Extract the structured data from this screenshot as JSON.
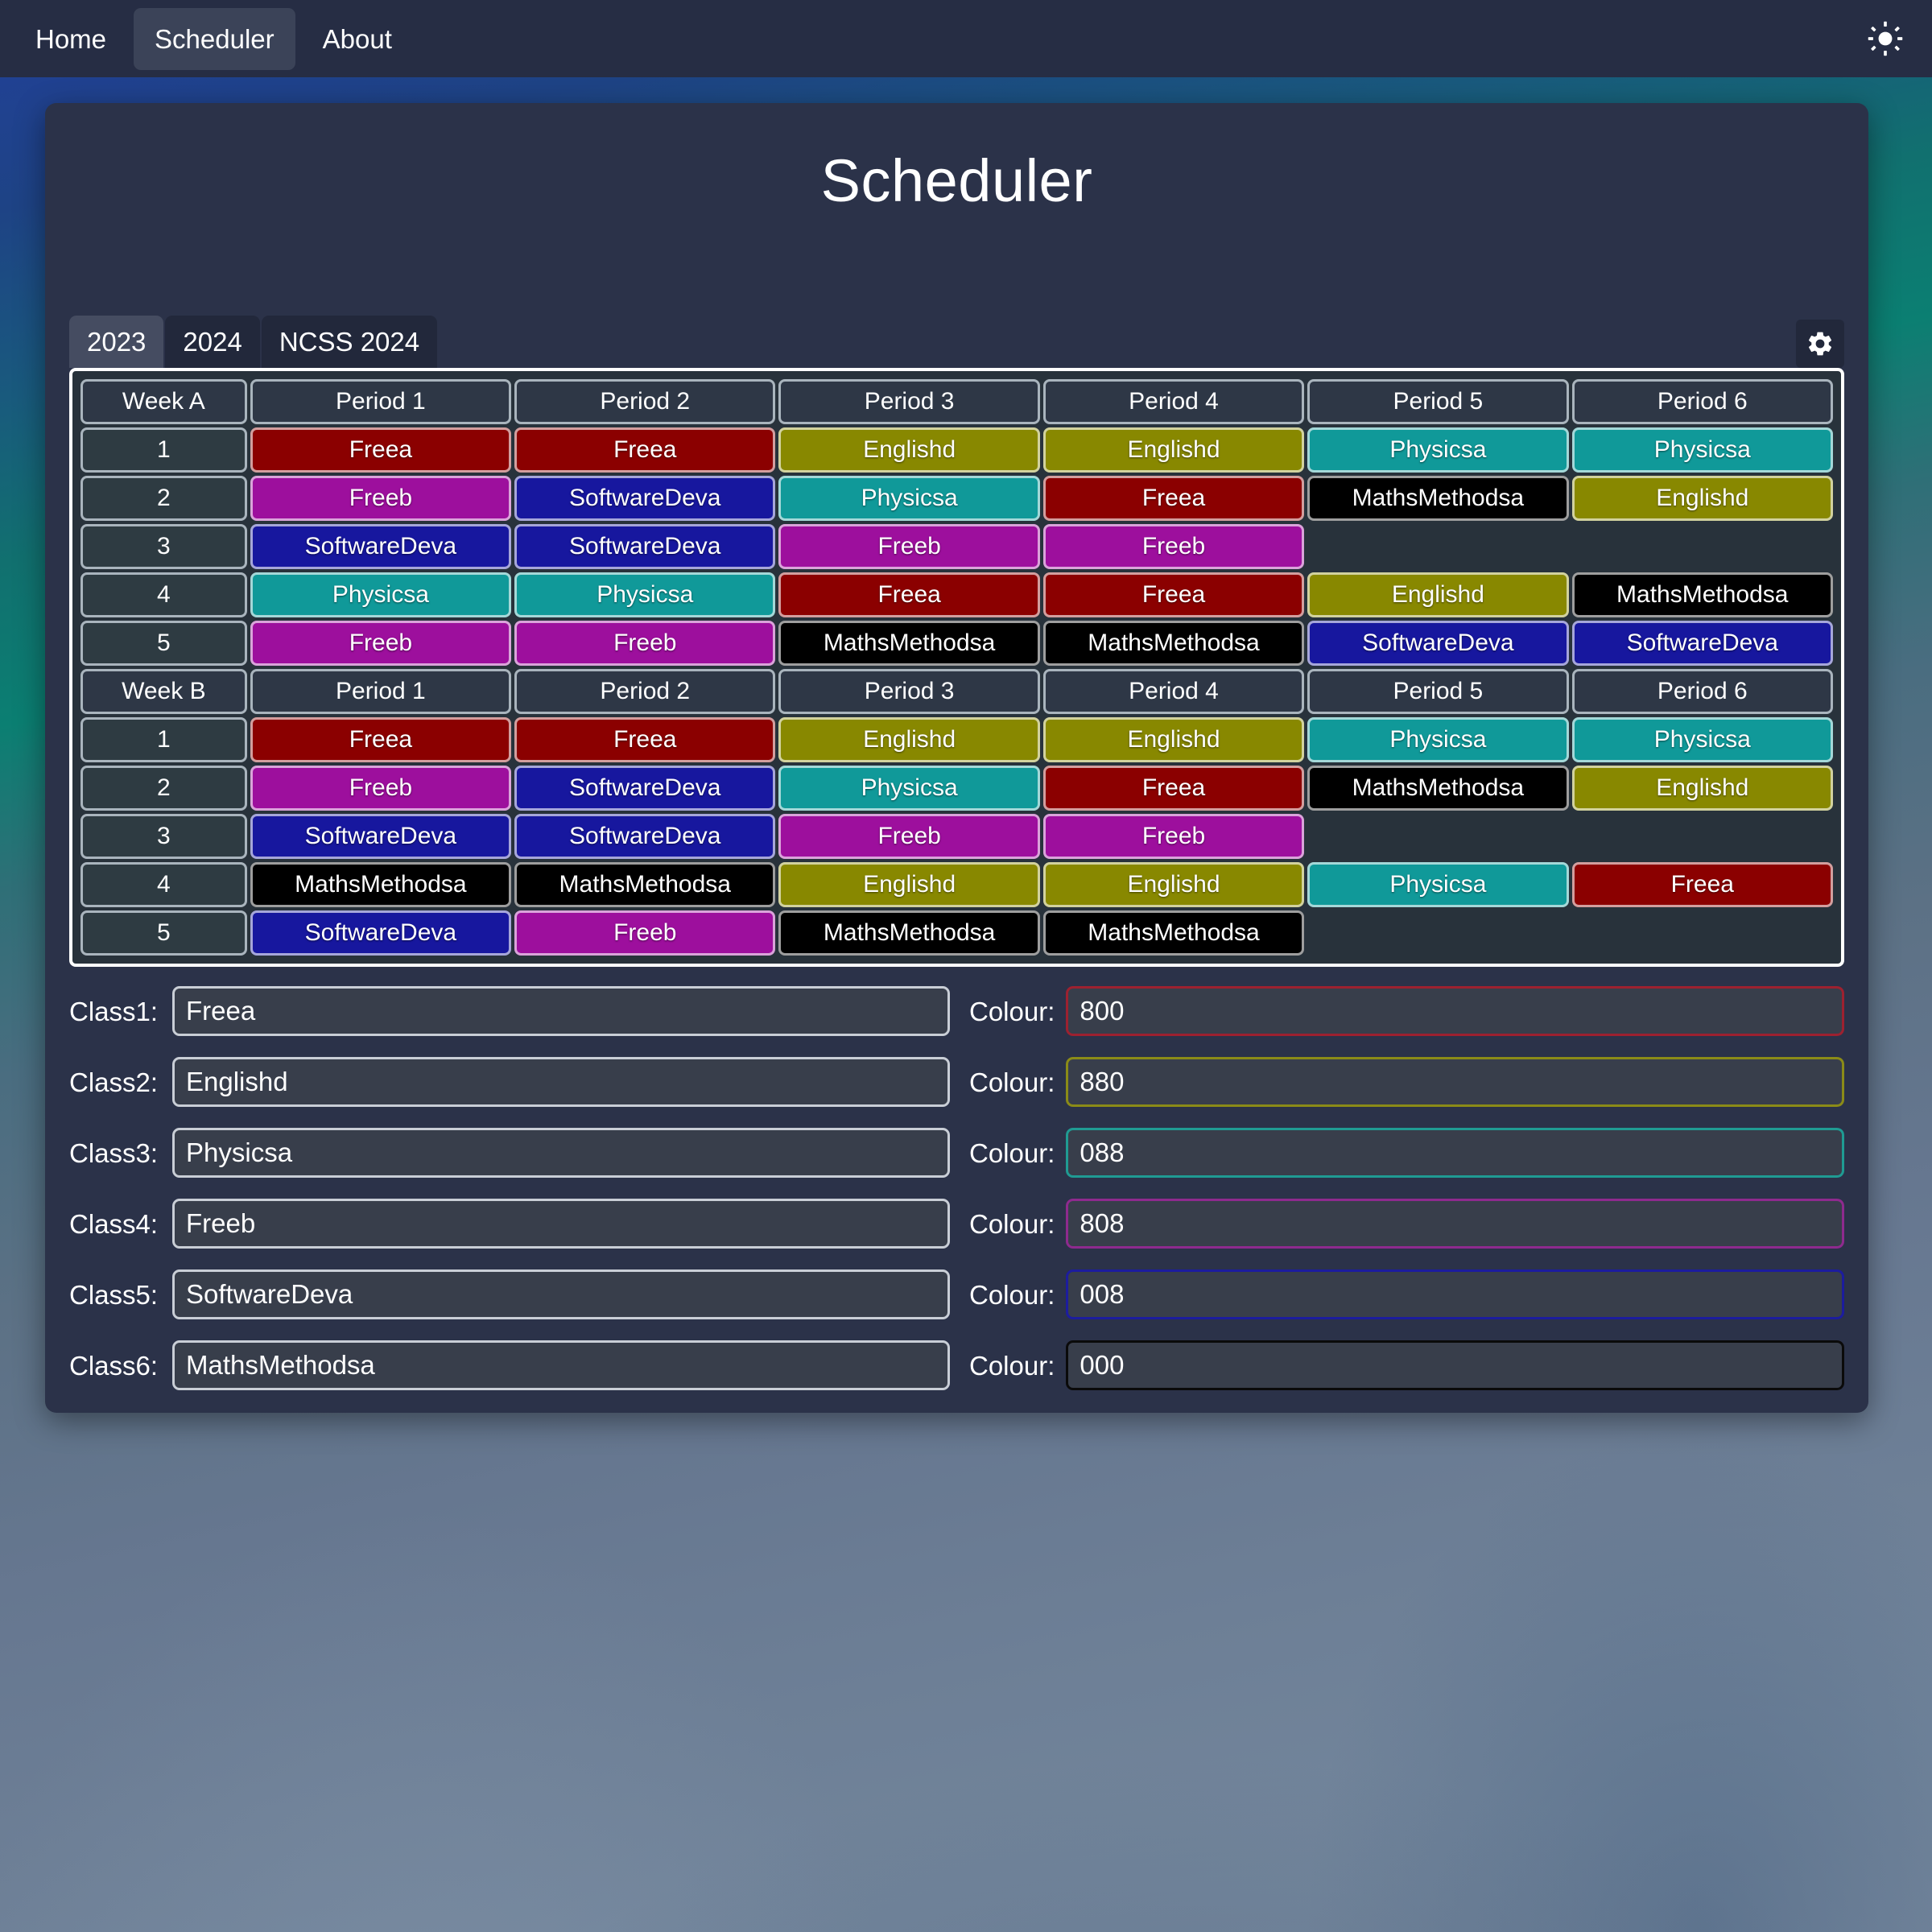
{
  "navbar": {
    "links": [
      {
        "label": "Home",
        "active": false
      },
      {
        "label": "Scheduler",
        "active": true
      },
      {
        "label": "About",
        "active": false
      }
    ],
    "theme_toggle_icon": "sun-icon"
  },
  "page": {
    "title": "Scheduler"
  },
  "tabs": {
    "items": [
      {
        "label": "2023",
        "active": true
      },
      {
        "label": "2024",
        "active": false
      },
      {
        "label": "NCSS 2024",
        "active": false
      }
    ],
    "settings_icon": "gear-icon"
  },
  "colours": {
    "Freea": "#8b0000",
    "Englishd": "#888800",
    "Physicsa": "#109999",
    "Freeb": "#9d0f9d",
    "SoftwareDeva": "#17179e",
    "MathsMethodsa": "#000000"
  },
  "timetable": {
    "weeks": [
      {
        "corner_label": "Week A",
        "period_headers": [
          "Period 1",
          "Period 2",
          "Period 3",
          "Period 4",
          "Period 5",
          "Period 6"
        ],
        "rows": [
          {
            "label": "1",
            "cells": [
              "Freea",
              "Freea",
              "Englishd",
              "Englishd",
              "Physicsa",
              "Physicsa"
            ]
          },
          {
            "label": "2",
            "cells": [
              "Freeb",
              "SoftwareDeva",
              "Physicsa",
              "Freea",
              "MathsMethodsa",
              "Englishd"
            ]
          },
          {
            "label": "3",
            "cells": [
              "SoftwareDeva",
              "SoftwareDeva",
              "Freeb",
              "Freeb",
              "",
              ""
            ]
          },
          {
            "label": "4",
            "cells": [
              "Physicsa",
              "Physicsa",
              "Freea",
              "Freea",
              "Englishd",
              "MathsMethodsa"
            ]
          },
          {
            "label": "5",
            "cells": [
              "Freeb",
              "Freeb",
              "MathsMethodsa",
              "MathsMethodsa",
              "SoftwareDeva",
              "SoftwareDeva"
            ]
          }
        ]
      },
      {
        "corner_label": "Week B",
        "period_headers": [
          "Period 1",
          "Period 2",
          "Period 3",
          "Period 4",
          "Period 5",
          "Period 6"
        ],
        "rows": [
          {
            "label": "1",
            "cells": [
              "Freea",
              "Freea",
              "Englishd",
              "Englishd",
              "Physicsa",
              "Physicsa"
            ]
          },
          {
            "label": "2",
            "cells": [
              "Freeb",
              "SoftwareDeva",
              "Physicsa",
              "Freea",
              "MathsMethodsa",
              "Englishd"
            ]
          },
          {
            "label": "3",
            "cells": [
              "SoftwareDeva",
              "SoftwareDeva",
              "Freeb",
              "Freeb",
              "",
              ""
            ]
          },
          {
            "label": "4",
            "cells": [
              "MathsMethodsa",
              "MathsMethodsa",
              "Englishd",
              "Englishd",
              "Physicsa",
              "Freea"
            ]
          },
          {
            "label": "5",
            "cells": [
              "SoftwareDeva",
              "Freeb",
              "MathsMethodsa",
              "MathsMethodsa",
              "",
              ""
            ]
          }
        ]
      }
    ]
  },
  "class_settings": {
    "colour_label": "Colour:",
    "rows": [
      {
        "label": "Class1:",
        "name": "Freea",
        "colour": "800",
        "border": "#9d2130"
      },
      {
        "label": "Class2:",
        "name": "Englishd",
        "colour": "880",
        "border": "#8b8b17"
      },
      {
        "label": "Class3:",
        "name": "Physicsa",
        "colour": "088",
        "border": "#1f9b93"
      },
      {
        "label": "Class4:",
        "name": "Freeb",
        "colour": "808",
        "border": "#8e2a8e"
      },
      {
        "label": "Class5:",
        "name": "SoftwareDeva",
        "colour": "008",
        "border": "#1c1c9e"
      },
      {
        "label": "Class6:",
        "name": "MathsMethodsa",
        "colour": "000",
        "border": "#0a0a0a"
      }
    ]
  }
}
